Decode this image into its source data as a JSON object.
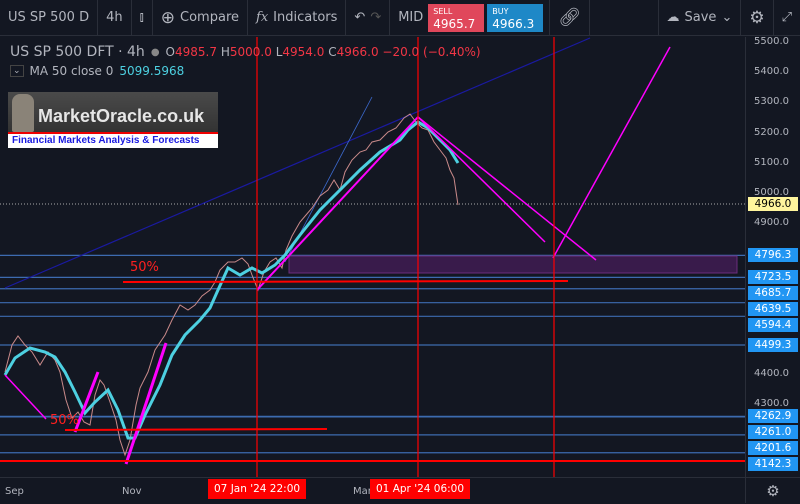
{
  "toolbar": {
    "symbol": "US SP 500 D",
    "interval": "4h",
    "compare": "Compare",
    "indicators": "Indicators",
    "mid": "MID",
    "sell_label": "SELL",
    "sell_price": "4965.7",
    "buy_label": "BUY",
    "buy_price": "4966.3",
    "save": "Save"
  },
  "legend": {
    "title": "US SP 500 DFT · 4h",
    "o_label": "O",
    "o": "4985.7",
    "h_label": "H",
    "h": "5000.0",
    "l_label": "L",
    "l": "4954.0",
    "c_label": "C",
    "c": "4966.0",
    "change": "−20.0 (−0.40%)",
    "ma_label": "MA 50 close 0",
    "ma_value": "5099.5968"
  },
  "logo": {
    "name": "MarketOracle.co.uk",
    "tagline": "Financial Markets Analysis & Forecasts"
  },
  "annotations": {
    "fib_upper": "50%",
    "fib_lower": "50%"
  },
  "price_axis": {
    "ticks": [
      "5500.0",
      "5400.0",
      "5300.0",
      "5200.0",
      "5100.0",
      "5000.0",
      "4900.0",
      "4400.0",
      "4300.0"
    ],
    "current": "4966.0",
    "levels": [
      "4796.3",
      "4723.5",
      "4685.7",
      "4639.5",
      "4594.4",
      "4499.3",
      "4262.9",
      "4261.0",
      "4201.6",
      "4142.3"
    ]
  },
  "time_axis": {
    "labels": [
      "Sep",
      "Nov",
      "Mar"
    ],
    "marker1": "07 Jan '24   22:00",
    "marker2": "01 Apr '24   06:00"
  },
  "colors": {
    "sell": "#e0475b",
    "buy": "#1e88c7",
    "level": "#2196f3",
    "ma": "#4dd0e1",
    "annotation": "#ff0000",
    "trend": "#ff00ff"
  }
}
